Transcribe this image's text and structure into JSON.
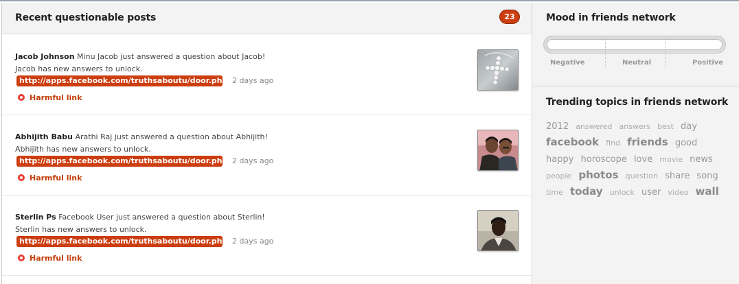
{
  "questionable_posts": {
    "title": "Recent questionable posts",
    "count": "23",
    "posts": [
      {
        "name": "Jacob Johnson",
        "message": "Minu Jacob just answered a question about Jacob!",
        "detail": "Jacob has new answers to unlock.",
        "link": "http://apps.facebook.com/truthsaboutu/door.ph...",
        "time": "2 days ago",
        "warning": "Harmful link",
        "thumbnail": "cross-pendant-photo"
      },
      {
        "name": "Abhijith Babu",
        "message": "Arathi Raj just answered a question about Abhijith!",
        "detail": "Abhijith has new answers to unlock.",
        "link": "http://apps.facebook.com/truthsaboutu/door.ph...",
        "time": "2 days ago",
        "warning": "Harmful link",
        "thumbnail": "two-people-photo"
      },
      {
        "name": "Sterlin Ps",
        "message": "Facebook User just answered a question about Sterlin!",
        "detail": "Sterlin has new answers to unlock.",
        "link": "http://apps.facebook.com/truthsaboutu/door.ph...",
        "time": "2 days ago",
        "warning": "Harmful link",
        "thumbnail": "person-portrait-photo"
      }
    ]
  },
  "mood": {
    "title": "Mood in friends network",
    "labels": [
      "Negative",
      "Neutral",
      "Positive"
    ]
  },
  "trending": {
    "title": "Trending topics in friends network",
    "topics": [
      {
        "word": "2012",
        "weight": 3
      },
      {
        "word": "answered",
        "weight": 1
      },
      {
        "word": "answers",
        "weight": 1
      },
      {
        "word": "best",
        "weight": 1
      },
      {
        "word": "day",
        "weight": 3
      },
      {
        "word": "facebook",
        "weight": 5
      },
      {
        "word": "find",
        "weight": 1
      },
      {
        "word": "friends",
        "weight": 5
      },
      {
        "word": "good",
        "weight": 3
      },
      {
        "word": "happy",
        "weight": 3
      },
      {
        "word": "horoscope",
        "weight": 3
      },
      {
        "word": "love",
        "weight": 3
      },
      {
        "word": "movie",
        "weight": 1
      },
      {
        "word": "news",
        "weight": 3
      },
      {
        "word": "people",
        "weight": 1
      },
      {
        "word": "photos",
        "weight": 5
      },
      {
        "word": "question",
        "weight": 1
      },
      {
        "word": "share",
        "weight": 3
      },
      {
        "word": "song",
        "weight": 3
      },
      {
        "word": "time",
        "weight": 1
      },
      {
        "word": "today",
        "weight": 5
      },
      {
        "word": "unlock",
        "weight": 1
      },
      {
        "word": "user",
        "weight": 3
      },
      {
        "word": "video",
        "weight": 1
      },
      {
        "word": "wall",
        "weight": 5
      }
    ]
  },
  "colors": {
    "accent": "#cc3d0f",
    "warning": "#c43e0a",
    "muted": "#9a9a9a"
  }
}
